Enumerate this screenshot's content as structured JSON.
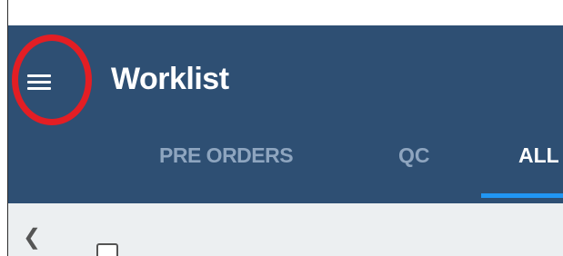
{
  "header": {
    "menu_icon": "hamburger-menu-icon",
    "title": "Worklist"
  },
  "tabs": [
    {
      "label": "PRE ORDERS",
      "active": false
    },
    {
      "label": "QC",
      "active": false
    },
    {
      "label": "ALL",
      "active": true
    }
  ],
  "toolbar": {
    "back_icon": "chevron-left-icon",
    "back_glyph": "❮"
  },
  "colors": {
    "appbar": "#2e4f73",
    "active_tab_indicator": "#2196f3",
    "highlight": "#e31e24",
    "inactive_tab_text": "#8ea5bf",
    "subbar": "#eceff1"
  }
}
